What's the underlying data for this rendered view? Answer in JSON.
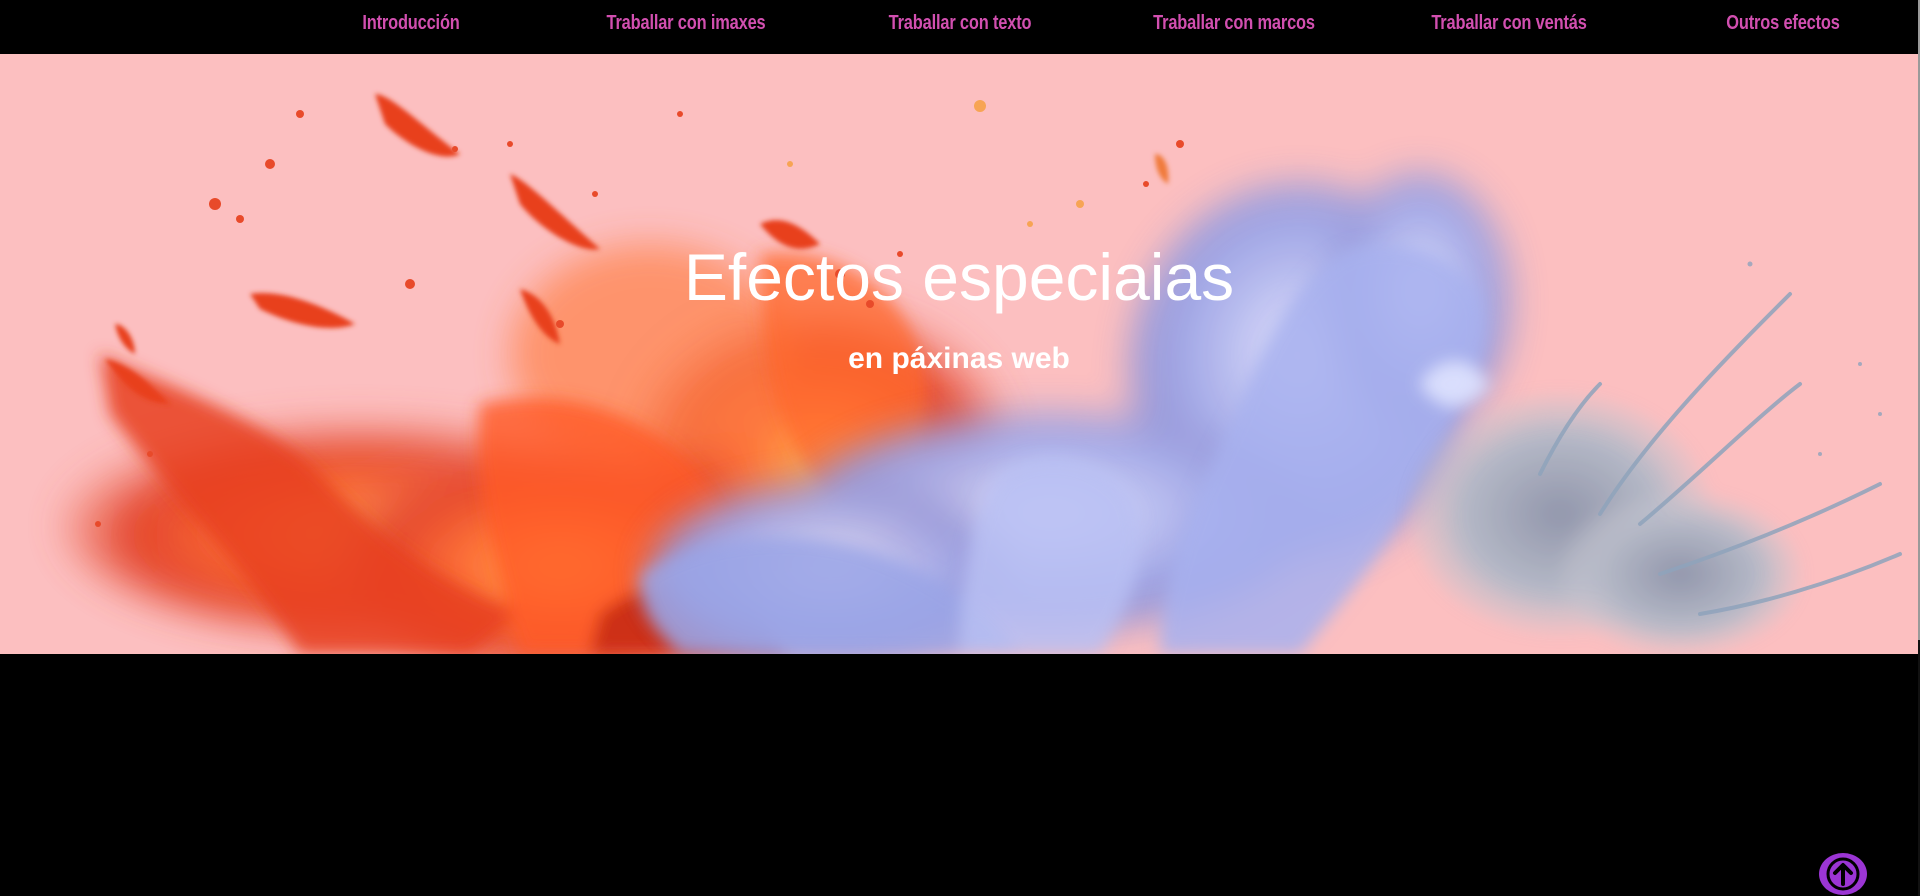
{
  "nav": {
    "items": [
      {
        "label": "Introducción"
      },
      {
        "label": "Traballar con imaxes"
      },
      {
        "label": "Traballar con texto"
      },
      {
        "label": "Traballar con marcos"
      },
      {
        "label": "Traballar con ventás"
      },
      {
        "label": "Outros efectos"
      }
    ]
  },
  "hero": {
    "title": "Efectos especiaias",
    "subtitle": "en páxinas web",
    "background_color": "#fcbfc0",
    "image_description_icon": "paint-splash-image"
  },
  "back_to_top": {
    "icon": "arrow-up-icon",
    "color": "#9b35d4"
  },
  "colors": {
    "nav_link": "#d24fb0",
    "page_background": "#000000",
    "hero_text": "#ffffff"
  }
}
